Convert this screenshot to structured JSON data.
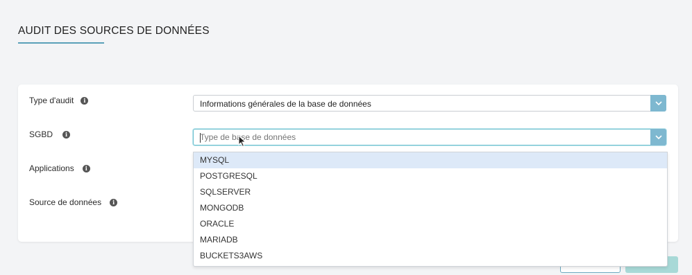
{
  "page": {
    "title": "AUDIT DES SOURCES DE DONNÉES"
  },
  "form": {
    "audit_type": {
      "label": "Type d'audit",
      "value": "Informations générales de la base de données"
    },
    "dbms": {
      "label": "SGBD",
      "placeholder": "Type de base de données"
    },
    "applications": {
      "label": "Applications"
    },
    "data_source": {
      "label": "Source de données"
    }
  },
  "dropdown": {
    "options": [
      "MYSQL",
      "POSTGRESQL",
      "SQLSERVER",
      "MONGODB",
      "ORACLE",
      "MARIADB",
      "BUCKETS3AWS"
    ],
    "highlighted": "MYSQL"
  },
  "colors": {
    "accent": "#5aa0b8",
    "select_button": "#7eb8d0",
    "highlight": "#dde9f8",
    "primary_button": "#a8d9d7"
  },
  "icons": {
    "info": "info-icon",
    "chevron": "chevron-down-icon"
  }
}
